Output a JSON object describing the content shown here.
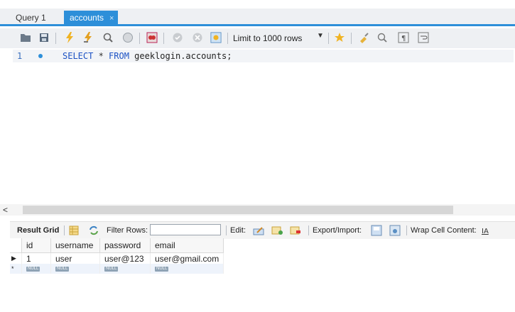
{
  "tabs": [
    {
      "label": "Query 1",
      "active": false
    },
    {
      "label": "accounts",
      "active": true
    }
  ],
  "tab_close": "×",
  "toolbar": {
    "limit_label": "Limit to 1000 rows"
  },
  "editor": {
    "line_number": "1",
    "sql": {
      "kw_select": "SELECT",
      "star": " * ",
      "kw_from": "FROM",
      "table": " geeklogin.accounts;"
    }
  },
  "result_bar": {
    "result_grid": "Result Grid",
    "filter_rows": "Filter Rows:",
    "edit": "Edit:",
    "export_import": "Export/Import:",
    "wrap_cell": "Wrap Cell Content:"
  },
  "grid": {
    "columns": [
      "id",
      "username",
      "password",
      "email"
    ],
    "rows": [
      [
        "1",
        "user",
        "user@123",
        "user@gmail.com"
      ]
    ],
    "null_label": "NULL"
  },
  "colors": {
    "accent": "#2d8fd9",
    "keyword": "#1c52c4"
  }
}
